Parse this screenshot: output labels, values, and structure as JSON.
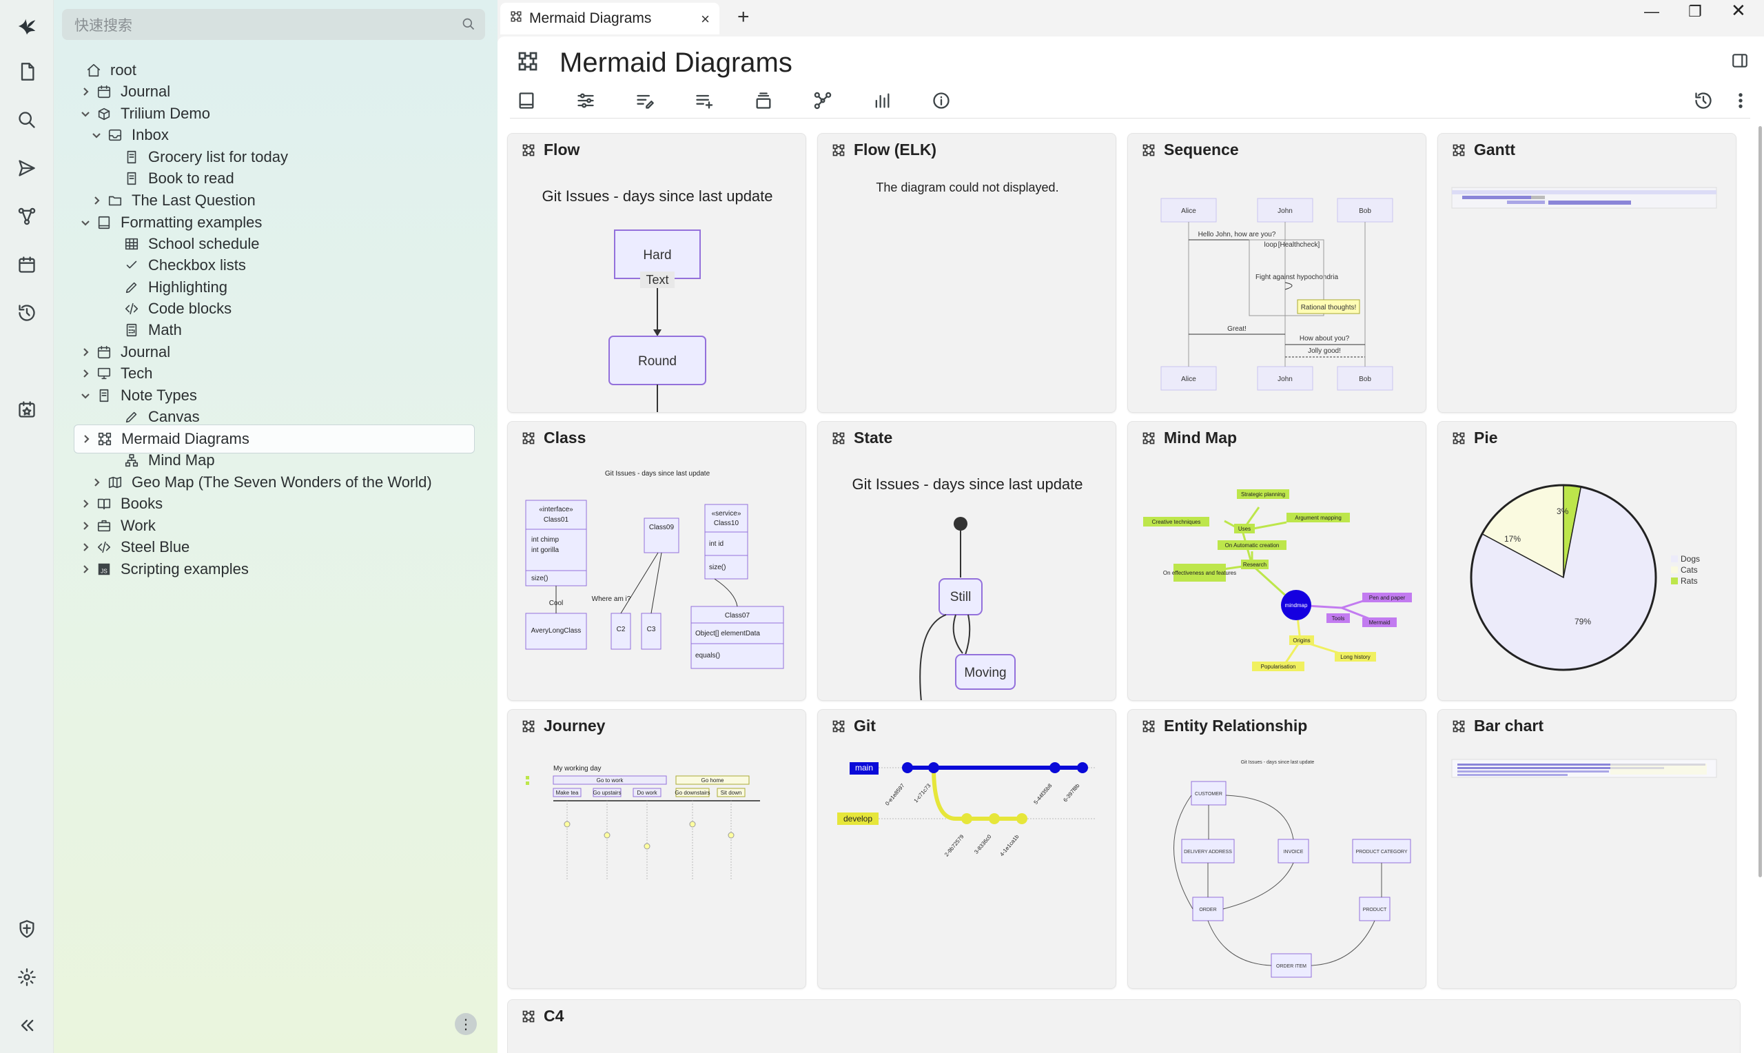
{
  "search": {
    "placeholder": "快速搜索"
  },
  "launcher": {
    "items": [
      "logo-icon",
      "new-note-icon",
      "search-icon",
      "send-icon",
      "graph-icon",
      "calendar-icon",
      "history-icon",
      "bookmark-calendar-icon",
      "shield-icon",
      "gear-icon",
      "collapse-icon"
    ]
  },
  "tree": {
    "items": [
      {
        "label": "root",
        "icon": "home-icon",
        "chev": ""
      },
      {
        "label": "Journal",
        "icon": "calendar-icon",
        "chev": "right"
      },
      {
        "label": "Trilium Demo",
        "icon": "box-icon",
        "chev": "down"
      },
      {
        "label": "Inbox",
        "icon": "inbox-icon",
        "chev": "down"
      },
      {
        "label": "Grocery list for today",
        "icon": "note-icon",
        "chev": ""
      },
      {
        "label": "Book to read",
        "icon": "note-icon",
        "chev": ""
      },
      {
        "label": "The Last Question",
        "icon": "folder-icon",
        "chev": "right"
      },
      {
        "label": "Formatting examples",
        "icon": "book-icon",
        "chev": "down"
      },
      {
        "label": "School schedule",
        "icon": "table-icon",
        "chev": ""
      },
      {
        "label": "Checkbox lists",
        "icon": "check-icon",
        "chev": ""
      },
      {
        "label": "Highlighting",
        "icon": "pen-icon",
        "chev": ""
      },
      {
        "label": "Code blocks",
        "icon": "code-icon",
        "chev": ""
      },
      {
        "label": "Math",
        "icon": "calculator-icon",
        "chev": ""
      },
      {
        "label": "Journal",
        "icon": "calendar-icon",
        "chev": "right"
      },
      {
        "label": "Tech",
        "icon": "monitor-icon",
        "chev": "right"
      },
      {
        "label": "Note Types",
        "icon": "note-icon",
        "chev": "down"
      },
      {
        "label": "Canvas",
        "icon": "pen-icon",
        "chev": ""
      },
      {
        "label": "Mermaid Diagrams",
        "icon": "mermaid-icon",
        "chev": "right"
      },
      {
        "label": "Mind Map",
        "icon": "mindmap-icon",
        "chev": ""
      },
      {
        "label": "Geo Map (The Seven Wonders of the World)",
        "icon": "map-icon",
        "chev": "right"
      },
      {
        "label": "Books",
        "icon": "book-open-icon",
        "chev": "right"
      },
      {
        "label": "Work",
        "icon": "briefcase-icon",
        "chev": "right"
      },
      {
        "label": "Steel Blue",
        "icon": "code-icon",
        "chev": "right"
      },
      {
        "label": "Scripting examples",
        "icon": "js-icon",
        "chev": "right"
      }
    ]
  },
  "tabs": [
    {
      "label": "Mermaid Diagrams"
    }
  ],
  "note": {
    "title": "Mermaid Diagrams"
  },
  "cards": {
    "flow": {
      "title": "Flow",
      "diagram_title": "Git Issues - days since last update",
      "node1": "Hard",
      "edge": "Text",
      "node2": "Round"
    },
    "flow_elk": {
      "title": "Flow (ELK)",
      "error": "The diagram could not displayed."
    },
    "sequence": {
      "title": "Sequence",
      "actors": [
        "Alice",
        "John",
        "Bob"
      ],
      "msg1": "Hello John, how are you?",
      "loop": "loop",
      "loop_label": "[Healthcheck]",
      "self": "Fight against hypochondria",
      "note": "Rational thoughts!",
      "msg2": "Great!",
      "msg3": "How about you?",
      "msg4": "Jolly good!"
    },
    "gantt": {
      "title": "Gantt"
    },
    "class": {
      "title": "Class",
      "diagram_title": "Git Issues - days since last update",
      "c1_stereo": "«interface»",
      "c1": "Class01",
      "c1_attr1": "int chimp",
      "c1_attr2": "int gorilla",
      "c1_m": "size()",
      "c9": "Class09",
      "c10_stereo": "«service»",
      "c10": "Class10",
      "c10_attr": "int id",
      "c10_m": "size()",
      "cool": "Cool",
      "where": "Where am i?",
      "alc": "AveryLongClass",
      "c2": "C2",
      "c3": "C3",
      "c7": "Class07",
      "c7_attr": "Object[] elementData",
      "c7_m": "equals()"
    },
    "state": {
      "title": "State",
      "diagram_title": "Git Issues - days since last update",
      "s1": "Still",
      "s2": "Moving"
    },
    "mindmap": {
      "title": "Mind Map",
      "root": "mindmap",
      "nodes": [
        "Strategic planning",
        "Creative techniques",
        "Argument mapping",
        "Uses",
        "On Automatic creation",
        "Research",
        "On effectiveness and features",
        "Tools",
        "Pen and paper",
        "Mermaid",
        "Origins",
        "Long history",
        "Popularisation"
      ]
    },
    "pie": {
      "title": "Pie",
      "slices": [
        {
          "label": "Dogs",
          "value": 79,
          "color": "#ecebfa"
        },
        {
          "label": "Cats",
          "value": 17,
          "color": "#fafae0"
        },
        {
          "label": "Rats",
          "value": 3,
          "color": "#bde64b"
        }
      ],
      "labels": [
        "79%",
        "17%",
        "3%"
      ]
    },
    "journey": {
      "title": "Journey",
      "diagram_title": "My working day",
      "sec1": "Go to work",
      "sec2": "Go home",
      "tasks": [
        "Make tea",
        "Go upstairs",
        "Do work",
        "Go downstairs",
        "Sit down"
      ]
    },
    "git": {
      "title": "Git",
      "branch_main": "main",
      "branch_dev": "develop",
      "commits_main": [
        "0-e1e8597",
        "1-c71c73",
        "5-44f35b8",
        "6-397f8b"
      ],
      "commits_dev": [
        "2-9b72579",
        "3-8336c0",
        "4-1e1ca1b"
      ]
    },
    "er": {
      "title": "Entity Relationship",
      "diagram_title": "Git Issues - days since last update",
      "entities": [
        "CUSTOMER",
        "DELIVERY ADDRESS",
        "INVOICE",
        "PRODUCT CATEGORY",
        "ORDER",
        "PRODUCT",
        "ORDER ITEM"
      ]
    },
    "bar": {
      "title": "Bar chart"
    },
    "c4": {
      "title": "C4"
    }
  }
}
